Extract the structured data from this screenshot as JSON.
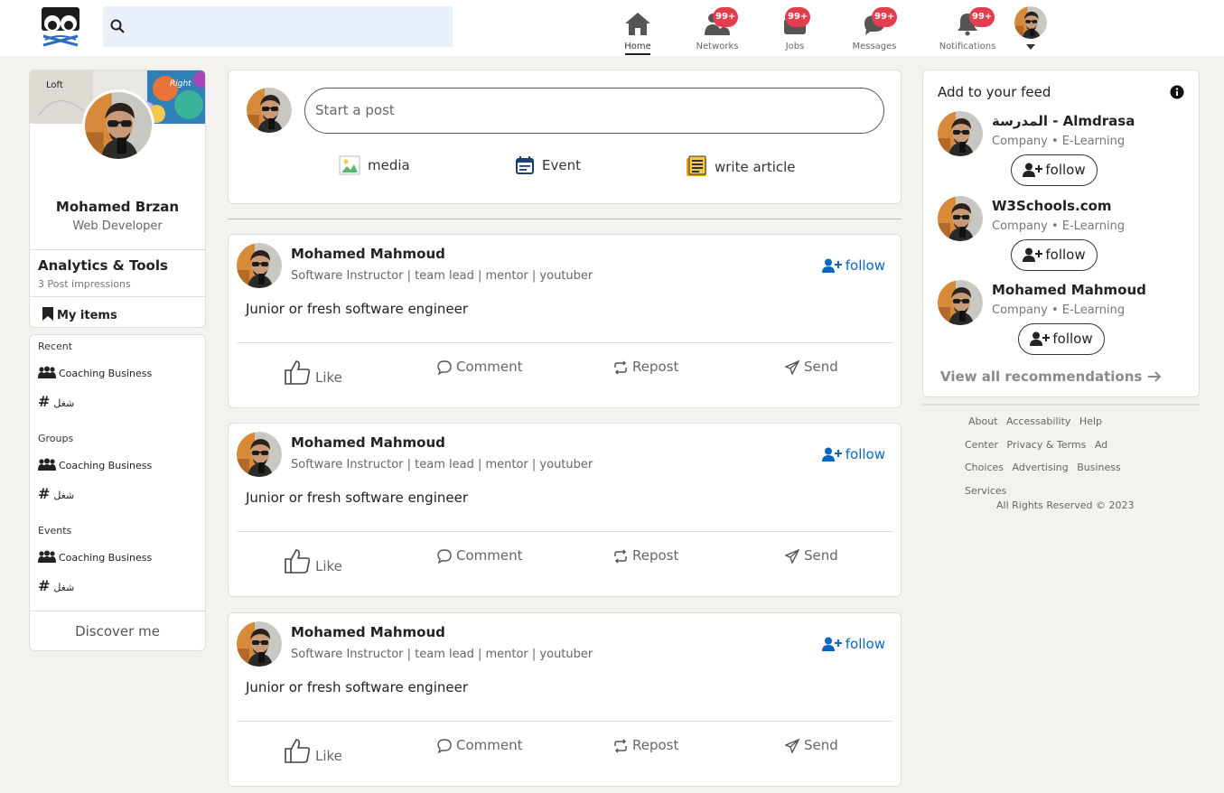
{
  "search": {
    "placeholder": ""
  },
  "nav": {
    "items": [
      {
        "label": "Home",
        "icon": "home-icon",
        "badge": ""
      },
      {
        "label": "Networks",
        "icon": "network-icon",
        "badge": "99+"
      },
      {
        "label": "Jobs",
        "icon": "briefcase-icon",
        "badge": "99+"
      },
      {
        "label": "Messages",
        "icon": "chat-icon",
        "badge": "99+"
      },
      {
        "label": "Notifications",
        "icon": "bell-icon",
        "badge": "99+"
      }
    ]
  },
  "profile": {
    "name": "Mohamed Brzan",
    "title": "Web Developer",
    "analytics_title": "Analytics & Tools",
    "analytics_sub": "3 Post impressions",
    "my_items": "My items",
    "cover_text_left": "Loft",
    "cover_text_right": "Right"
  },
  "sections": [
    {
      "heading": "Recent",
      "item": "Coaching Business",
      "hashtag": "شغل"
    },
    {
      "heading": "Groups",
      "item": "Coaching Business",
      "hashtag": "شغل"
    },
    {
      "heading": "Events",
      "item": "Coaching Business",
      "hashtag": "شغل"
    }
  ],
  "discover": "Discover me",
  "compose": {
    "placeholder": "Start a post",
    "actions": [
      "media",
      "Event",
      "write article"
    ]
  },
  "posts": [
    {
      "author": "Mohamed Mahmoud",
      "headline": "Software Instructor | team lead | mentor | youtuber",
      "follow": "follow",
      "text": "Junior or fresh software engineer"
    },
    {
      "author": "Mohamed Mahmoud",
      "headline": "Software Instructor | team lead | mentor | youtuber",
      "follow": "follow",
      "text": "Junior or fresh software engineer"
    },
    {
      "author": "Mohamed Mahmoud",
      "headline": "Software Instructor | team lead | mentor | youtuber",
      "follow": "follow",
      "text": "Junior or fresh software engineer"
    }
  ],
  "post_actions": [
    "Like",
    "Comment",
    "Repost",
    "Send"
  ],
  "feed": {
    "title": "Add to your feed",
    "recommendations": [
      {
        "name": "المدرسة - Almdrasa",
        "sub": "Company • E-Learning",
        "button": "follow"
      },
      {
        "name": "W3Schools.com",
        "sub": "Company • E-Learning",
        "button": "follow"
      },
      {
        "name": "Mohamed Mahmoud",
        "sub": "Company • E-Learning",
        "button": "follow"
      }
    ],
    "view_all": "View all recommendations"
  },
  "footer": {
    "links": [
      "About",
      "Accessability",
      "Help",
      "Center",
      "Privacy & Terms",
      "Ad",
      "Choices",
      "Advertising",
      "Business",
      "Services"
    ],
    "rights": "All Rights Reserved © 2023"
  },
  "colors": {
    "accent": "#0a66c2",
    "badge": "#e33d4e",
    "background": "#f3f2ef"
  }
}
